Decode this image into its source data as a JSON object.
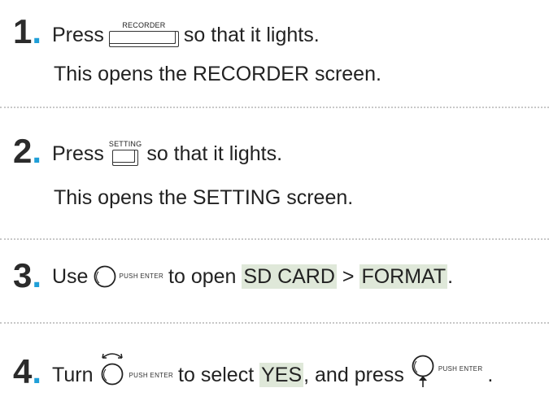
{
  "steps": [
    {
      "number": "1",
      "dot": ".",
      "before": "Press",
      "button_label": "RECORDER",
      "after": "so that it lights.",
      "sub": "This opens the RECORDER screen."
    },
    {
      "number": "2",
      "dot": ".",
      "before": "Press",
      "button_label": "SETTING",
      "after": "so that it lights.",
      "sub": "This opens the SETTING screen."
    },
    {
      "number": "3",
      "dot": ".",
      "before": "Use",
      "dial_caption": "PUSH ENTER",
      "after1": "to open",
      "hl1": "SD CARD",
      "sep": ">",
      "hl2": "FORMAT",
      "end": "."
    },
    {
      "number": "4",
      "dot": ".",
      "before": "Turn",
      "dial_caption": "PUSH ENTER",
      "mid1": "to select",
      "hl": "YES",
      "mid2": ", and press",
      "dial2_caption": "PUSH ENTER",
      "end": "."
    }
  ],
  "colors": {
    "accent": "#1f9fd8",
    "highlight": "#dfe8d9"
  }
}
